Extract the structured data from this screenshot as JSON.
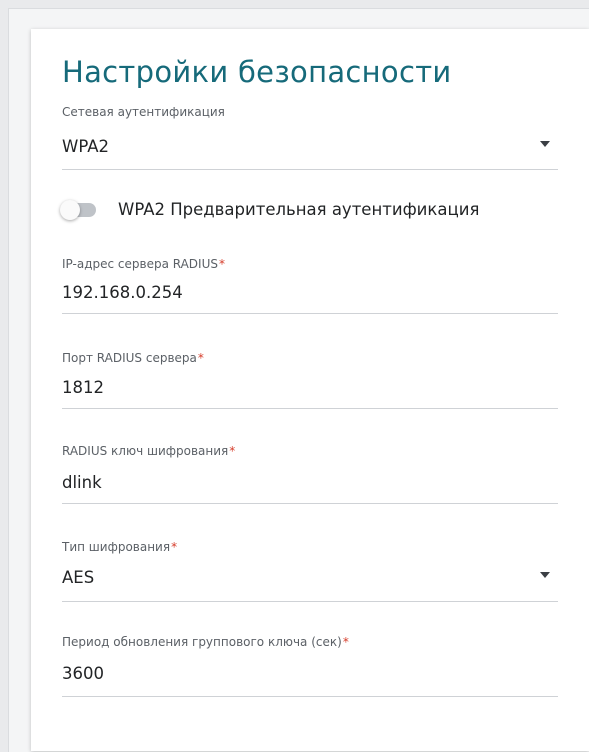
{
  "card": {
    "title": "Настройки безопасности"
  },
  "fields": {
    "auth": {
      "label": "Сетевая аутентификация",
      "value": "WPA2",
      "required": false
    },
    "radius_ip": {
      "label": "IP-адрес сервера RADIUS",
      "value": "192.168.0.254",
      "required_mark": "*"
    },
    "radius_port": {
      "label": "Порт RADIUS сервера",
      "value": "1812",
      "required_mark": "*"
    },
    "radius_key": {
      "label": "RADIUS ключ шифрования",
      "value": "dlink",
      "required_mark": "*"
    },
    "cipher": {
      "label": "Тип шифрования",
      "value": "AES",
      "required_mark": "*"
    },
    "group_key_period": {
      "label": "Период обновления группового ключа (сек)",
      "value": "3600",
      "required_mark": "*"
    }
  },
  "preauth_toggle": {
    "label": "WPA2 Предварительная аутентификация",
    "enabled": false
  },
  "icons": {
    "dropdown": "chevron-down-icon"
  },
  "colors": {
    "title": "#166a7a",
    "required": "#d63c2a",
    "toggle_off": "#bfc3c8"
  }
}
